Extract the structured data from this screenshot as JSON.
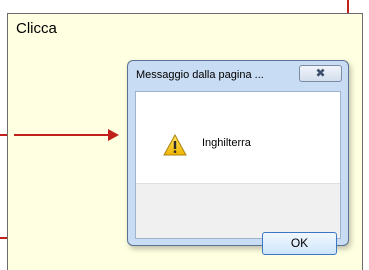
{
  "page": {
    "text": "Clicca"
  },
  "dialog": {
    "title": "Messaggio dalla pagina ...",
    "close_glyph": "✖",
    "message": "Inghilterra",
    "ok_label": "OK",
    "icon": "warning-icon"
  },
  "colors": {
    "page_background": "#ffffe1",
    "annotation_red": "#c1201b",
    "dialog_frame": "#c8dcf3"
  }
}
